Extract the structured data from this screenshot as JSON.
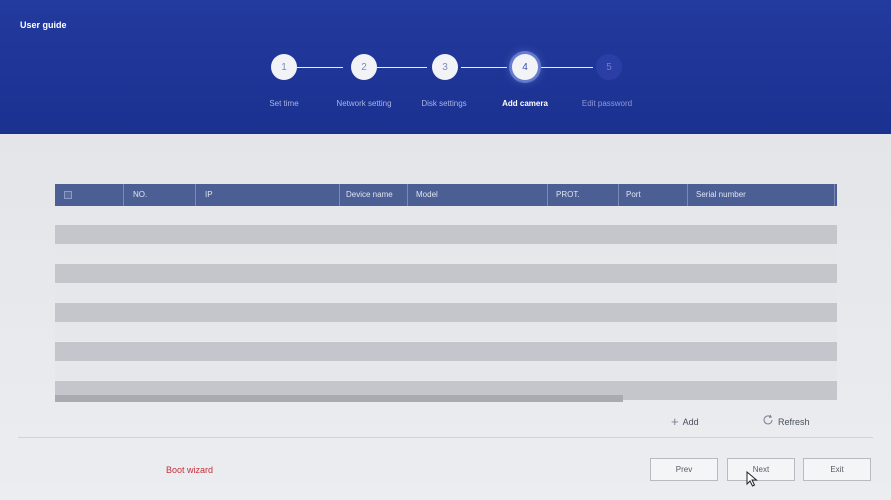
{
  "app": {
    "title": "User guide"
  },
  "steps": [
    {
      "number": "1",
      "label": "Set time"
    },
    {
      "number": "2",
      "label": "Network setting"
    },
    {
      "number": "3",
      "label": "Disk settings"
    },
    {
      "number": "4",
      "label": "Add camera"
    },
    {
      "number": "5",
      "label": "Edit password"
    }
  ],
  "current_step": 4,
  "table": {
    "columns": [
      "NO.",
      "IP",
      "Device name",
      "Model",
      "PROT.",
      "Port",
      "Serial number"
    ],
    "rows": []
  },
  "actions": {
    "add_label": "Add",
    "refresh_label": "Refresh"
  },
  "footer": {
    "boot_wizard_label": "Boot wizard",
    "prev_label": "Prev",
    "next_label": "Next",
    "exit_label": "Exit"
  },
  "colors": {
    "header": "#1e3596",
    "table_header": "#4c5f94",
    "boot_wizard": "#c4303a"
  }
}
